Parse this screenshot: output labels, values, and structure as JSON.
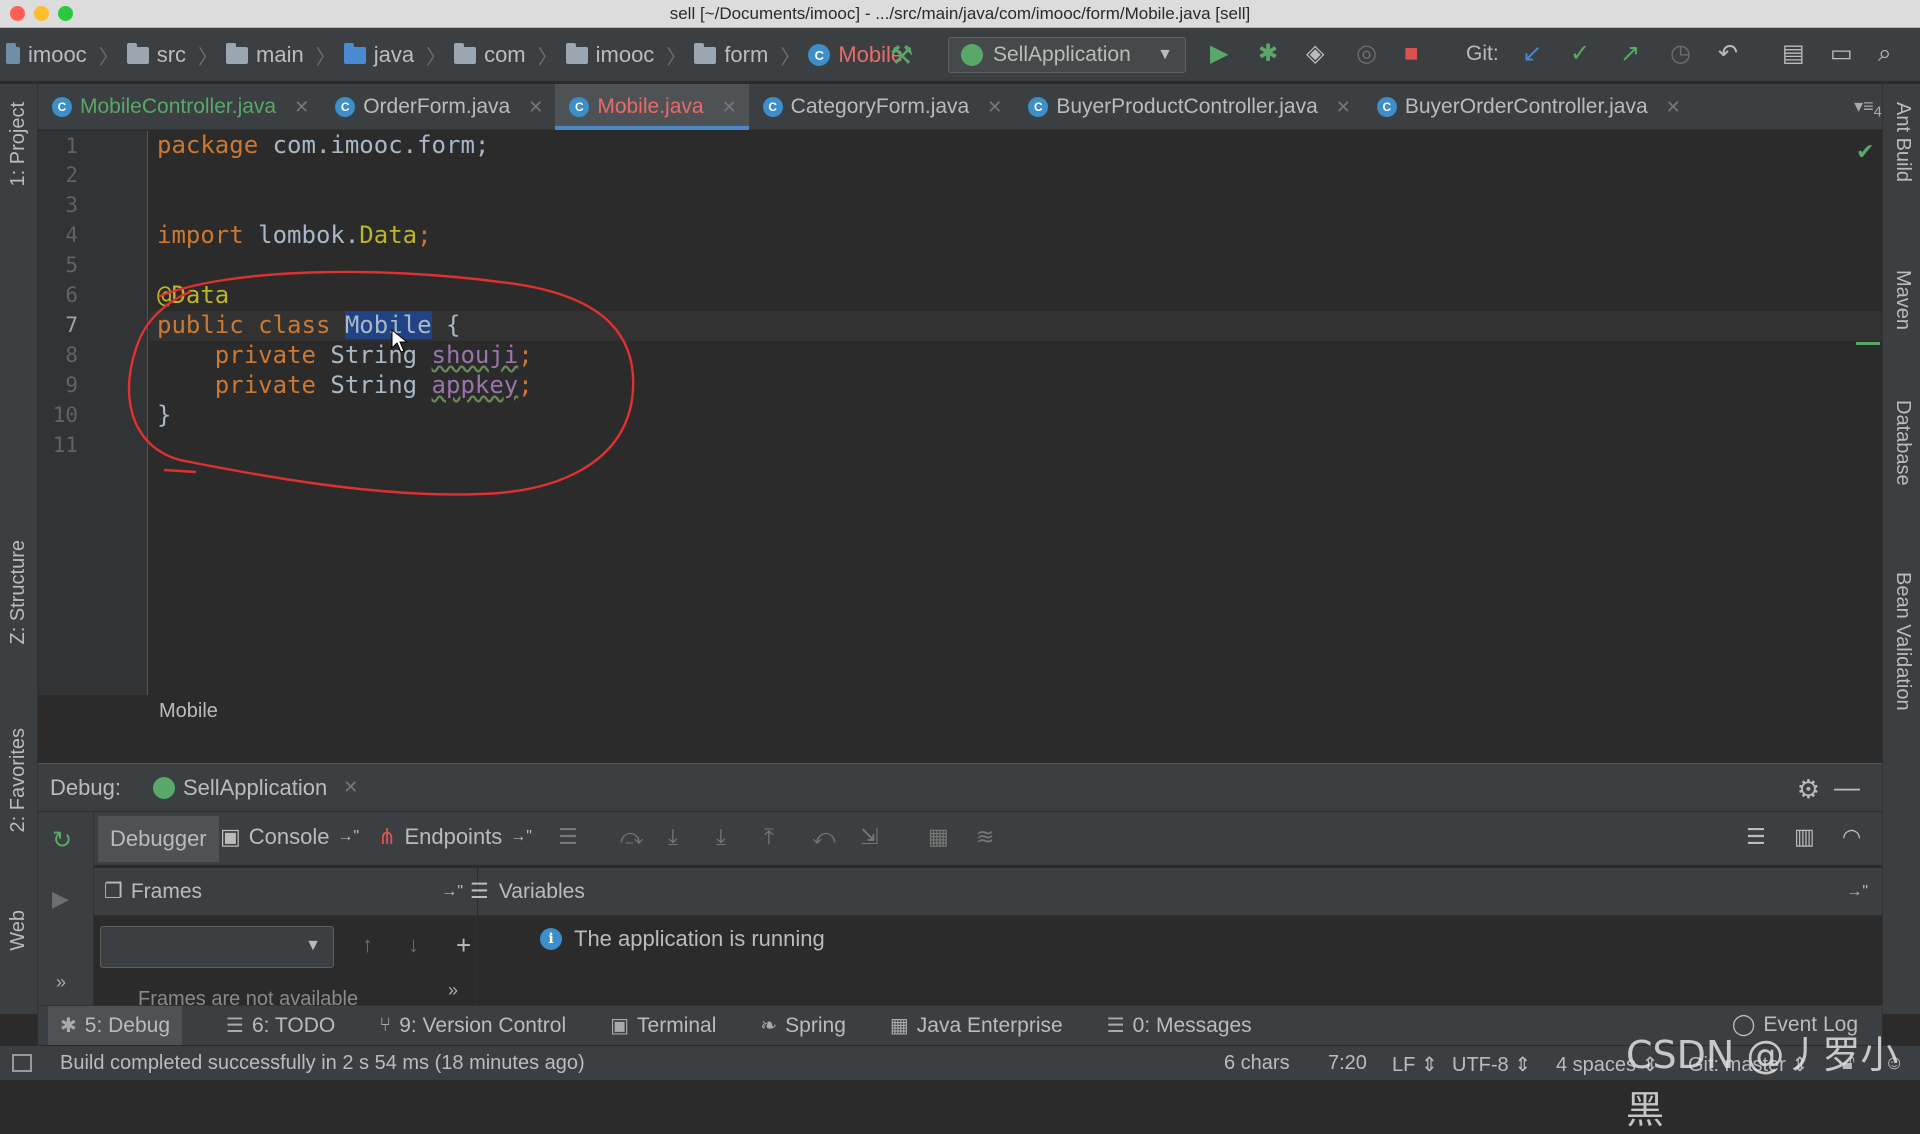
{
  "window": {
    "title": "sell [~/Documents/imooc] - .../src/main/java/com/imooc/form/Mobile.java [sell]"
  },
  "breadcrumbs": [
    {
      "label": "imooc",
      "icon": "project-icon"
    },
    {
      "label": "src",
      "icon": "folder-icon"
    },
    {
      "label": "main",
      "icon": "folder-icon"
    },
    {
      "label": "java",
      "icon": "folder-icon"
    },
    {
      "label": "com",
      "icon": "package-icon"
    },
    {
      "label": "imooc",
      "icon": "package-icon"
    },
    {
      "label": "form",
      "icon": "package-icon"
    },
    {
      "label": "Mobile",
      "icon": "class-icon"
    }
  ],
  "toolbar": {
    "run_config": "SellApplication",
    "git_label": "Git:"
  },
  "tabs": [
    {
      "label": "MobileController.java",
      "state": "modified"
    },
    {
      "label": "OrderForm.java",
      "state": "normal"
    },
    {
      "label": "Mobile.java",
      "state": "active"
    },
    {
      "label": "CategoryForm.java",
      "state": "normal"
    },
    {
      "label": "BuyerProductController.java",
      "state": "normal"
    },
    {
      "label": "BuyerOrderController.java",
      "state": "normal"
    }
  ],
  "tabs_overflow": "4",
  "left_tool_windows": [
    "1: Project",
    "Z: Structure",
    "2: Favorites",
    "Web"
  ],
  "right_tool_windows": [
    "Ant Build",
    "Maven",
    "Database",
    "Bean Validation"
  ],
  "editor": {
    "line_numbers": [
      "1",
      "2",
      "3",
      "4",
      "5",
      "6",
      "7",
      "8",
      "9",
      "10",
      "11"
    ],
    "code": {
      "l1_kw": "package",
      "l1_rest": " com.imooc.form;",
      "l4_kw": "import",
      "l4_rest": " lombok.",
      "l4_class": "Data",
      "l4_end": ";",
      "l6_ann": "@Data",
      "l7_kw": "public class",
      "l7_space": " ",
      "l7_class": "Mobile",
      "l7_rest": " {",
      "l8_kw": "    private",
      "l8_type": " String ",
      "l8_field": "shouji",
      "l8_end": ";",
      "l9_kw": "    private",
      "l9_type": " String ",
      "l9_field": "appkey",
      "l9_end": ";",
      "l10": "}"
    },
    "breadcrumb": "Mobile",
    "colors": {
      "keyword": "#cc7832",
      "annotation": "#bbb529",
      "field": "#9876aa",
      "plain": "#a9b7c6",
      "selection": "#214283",
      "annotation_circle": "#e03030"
    }
  },
  "debug": {
    "label": "Debug:",
    "session": "SellApplication",
    "tabs": {
      "debugger": "Debugger",
      "console": "Console",
      "endpoints": "Endpoints"
    },
    "frames": {
      "title": "Frames",
      "message": "Frames are not available"
    },
    "variables": {
      "title": "Variables",
      "message": "The application is running"
    }
  },
  "bottom_tabs": [
    {
      "label": "5: Debug",
      "icon": "bug-icon"
    },
    {
      "label": "6: TODO",
      "icon": "list-icon"
    },
    {
      "label": "9: Version Control",
      "icon": "vcs-icon"
    },
    {
      "label": "Terminal",
      "icon": "terminal-icon"
    },
    {
      "label": "Spring",
      "icon": "spring-icon"
    },
    {
      "label": "Java Enterprise",
      "icon": "enterprise-icon"
    },
    {
      "label": "0: Messages",
      "icon": "messages-icon"
    }
  ],
  "event_log": "Event Log",
  "status": {
    "message": "Build completed successfully in 2 s 54 ms (18 minutes ago)",
    "chars": "6 chars",
    "position": "7:20",
    "line_sep": "LF",
    "encoding": "UTF-8",
    "indent": "4 spaces",
    "git_branch": "Git: master"
  },
  "watermark": "CSDN @丿罗小黑"
}
